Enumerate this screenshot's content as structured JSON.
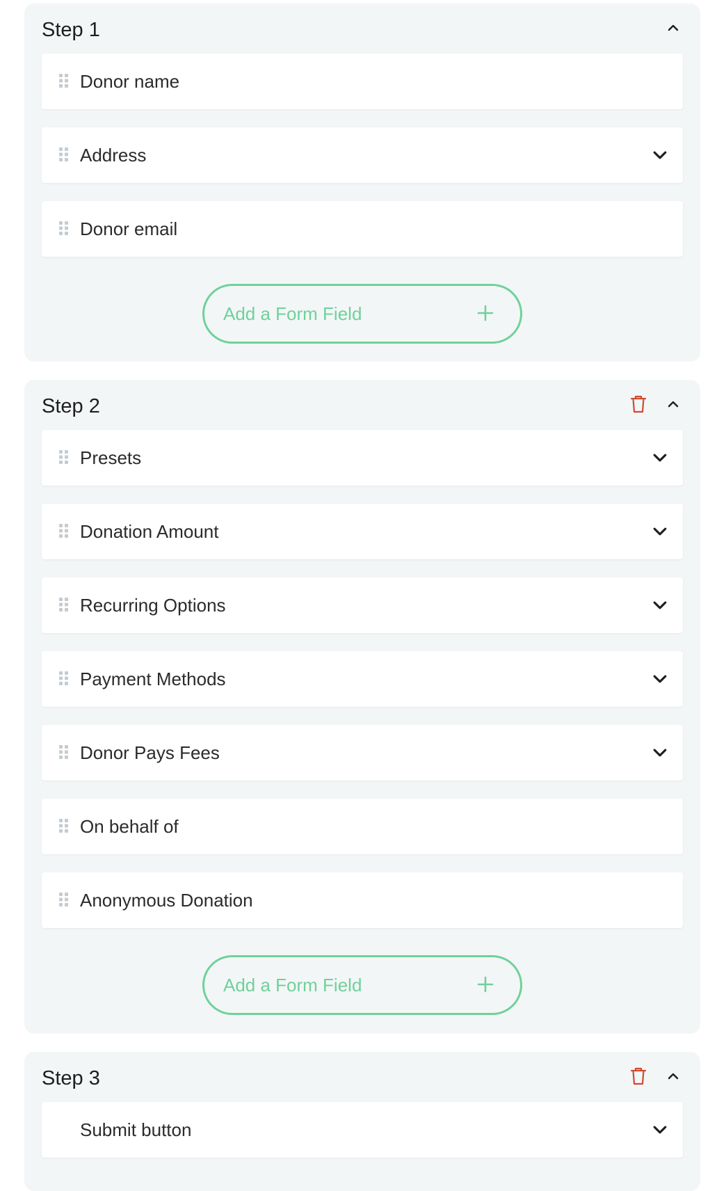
{
  "colors": {
    "accent": "#6fd19b",
    "delete": "#d24a2f",
    "panel": "#f3f6f7"
  },
  "steps": [
    {
      "title": "Step 1",
      "has_delete": false,
      "fields": [
        {
          "label": "Donor name",
          "draggable": true,
          "expandable": false
        },
        {
          "label": "Address",
          "draggable": true,
          "expandable": true
        },
        {
          "label": "Donor email",
          "draggable": true,
          "expandable": false
        }
      ],
      "add_button": "Add a Form Field"
    },
    {
      "title": "Step 2",
      "has_delete": true,
      "fields": [
        {
          "label": "Presets",
          "draggable": true,
          "expandable": true
        },
        {
          "label": "Donation Amount",
          "draggable": true,
          "expandable": true
        },
        {
          "label": "Recurring Options",
          "draggable": true,
          "expandable": true
        },
        {
          "label": "Payment Methods",
          "draggable": true,
          "expandable": true
        },
        {
          "label": "Donor Pays Fees",
          "draggable": true,
          "expandable": true
        },
        {
          "label": "On behalf of",
          "draggable": true,
          "expandable": false
        },
        {
          "label": "Anonymous Donation",
          "draggable": true,
          "expandable": false
        }
      ],
      "add_button": "Add a Form Field"
    },
    {
      "title": "Step 3",
      "has_delete": true,
      "fields": [
        {
          "label": "Submit button",
          "draggable": false,
          "expandable": true
        }
      ]
    }
  ],
  "icons": {
    "collapse": "chevron-up-icon",
    "expand": "chevron-down-icon",
    "delete": "trash-icon",
    "drag": "drag-handle-icon",
    "add": "plus-icon"
  }
}
